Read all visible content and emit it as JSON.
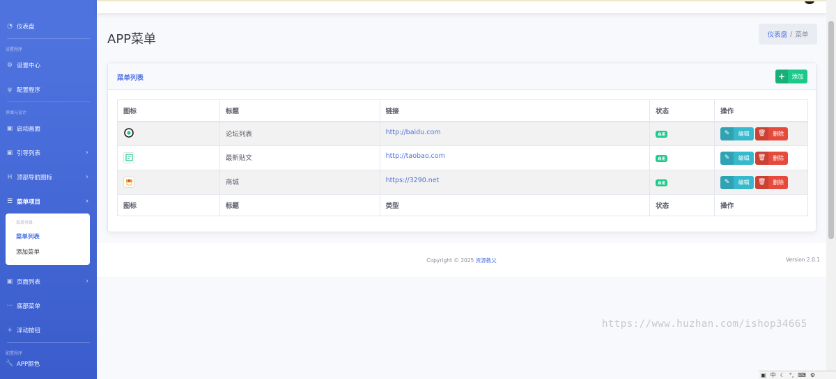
{
  "sidebar": {
    "dashboard": "仪表盘",
    "heading_setup": "设置程序",
    "settings_center": "设置中心",
    "config_program": "配置程序",
    "heading_interface": "界面与设计",
    "splash": "启动画面",
    "guide_list": "引导列表",
    "top_nav_icons": "顶部导航图标",
    "menu_items": "菜单项目",
    "submenu": {
      "heading": "菜单项目:",
      "items": [
        "菜单列表",
        "添加菜单"
      ]
    },
    "page_list": "页面列表",
    "bottom_menu": "底部菜单",
    "float_button": "浮动按钮",
    "heading_config": "配置程序",
    "app_colors": "APP颜色"
  },
  "page": {
    "title": "APP菜单",
    "breadcrumb": {
      "home": "仪表盘",
      "sep": "/",
      "current": "菜单"
    }
  },
  "card": {
    "title": "菜单列表",
    "add_button": "添加",
    "table": {
      "headers": [
        "图标",
        "标题",
        "链接",
        "状态",
        "操作"
      ],
      "footers": [
        "图标",
        "标题",
        "类型",
        "状态",
        "操作"
      ],
      "rows": [
        {
          "title": "论坛列表",
          "link": "http://baidu.com",
          "status": "启用",
          "edit": "编辑",
          "delete": "删除"
        },
        {
          "title": "最新贴文",
          "link": "http://taobao.com",
          "status": "启用",
          "edit": "编辑",
          "delete": "删除"
        },
        {
          "title": "商城",
          "link": "https://3290.net",
          "status": "启用",
          "edit": "编辑",
          "delete": "删除"
        }
      ]
    }
  },
  "footer": {
    "copyright_prefix": "Copyright © 2025",
    "brand": "资源教父",
    "version": "Version 2.0.1"
  },
  "watermark": "https://www.huzhan.com/ishop34665",
  "ime": {
    "label": "中"
  },
  "colors": {
    "sidebar": "#4e73df",
    "success": "#1cc88a",
    "info": "#36b9cc",
    "danger": "#e74a3b"
  }
}
